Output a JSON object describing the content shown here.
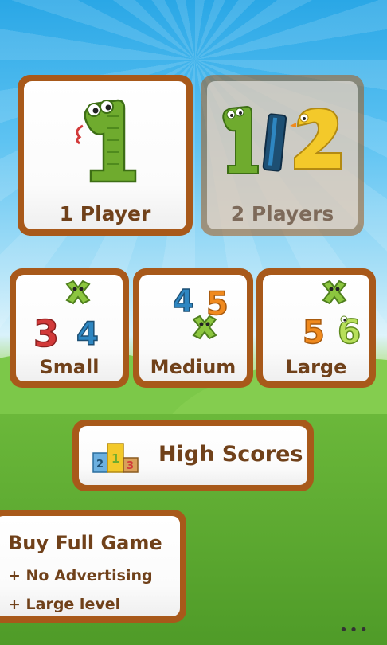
{
  "modes": {
    "one_player": "1 Player",
    "two_players": "2 Players"
  },
  "sizes": {
    "small": "Small",
    "medium": "Medium",
    "large": "Large"
  },
  "high_scores": {
    "label": "High Scores",
    "podium_numbers": [
      "2",
      "1",
      "3"
    ]
  },
  "buy": {
    "title": "Buy Full Game",
    "feature_1": "+ No Advertising",
    "feature_2": "+ Large level"
  },
  "menu": {
    "dots": "•••"
  },
  "mascots": {
    "one": "1",
    "two": "2",
    "three": "3",
    "four": "4",
    "five": "5",
    "six": "6"
  },
  "colors": {
    "card_border": "#a8591a",
    "label_text": "#70411a",
    "snake_green": "#6fab2e",
    "red": "#d23a3a",
    "blue": "#2e86c1",
    "orange": "#f08a1e",
    "yellow": "#f3c92a"
  }
}
